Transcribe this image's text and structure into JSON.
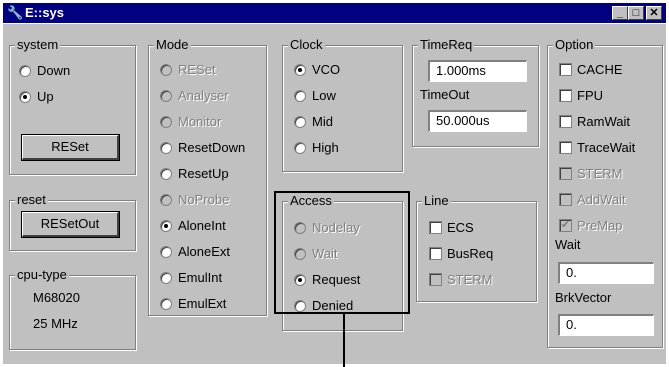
{
  "window": {
    "title": "E::sys",
    "icon": "wrench-icon"
  },
  "titlebar_buttons": {
    "minimize": "_",
    "maximize": "□",
    "close": "✕"
  },
  "system": {
    "title": "system",
    "options": [
      {
        "label": "Down",
        "selected": false
      },
      {
        "label": "Up",
        "selected": true
      }
    ],
    "button": "RESet"
  },
  "reset": {
    "title": "reset",
    "button": "RESetOut"
  },
  "cpu": {
    "title": "cpu-type",
    "model": "M68020",
    "speed": "25 MHz"
  },
  "mode": {
    "title": "Mode",
    "options": [
      {
        "label": "RESet",
        "selected": false,
        "enabled": false
      },
      {
        "label": "Analyser",
        "selected": false,
        "enabled": false
      },
      {
        "label": "Monitor",
        "selected": false,
        "enabled": false
      },
      {
        "label": "ResetDown",
        "selected": false,
        "enabled": true
      },
      {
        "label": "ResetUp",
        "selected": false,
        "enabled": true
      },
      {
        "label": "NoProbe",
        "selected": false,
        "enabled": false
      },
      {
        "label": "AloneInt",
        "selected": true,
        "enabled": true
      },
      {
        "label": "AloneExt",
        "selected": false,
        "enabled": true
      },
      {
        "label": "EmulInt",
        "selected": false,
        "enabled": true
      },
      {
        "label": "EmulExt",
        "selected": false,
        "enabled": true
      }
    ]
  },
  "clock": {
    "title": "Clock",
    "options": [
      {
        "label": "VCO",
        "selected": true
      },
      {
        "label": "Low",
        "selected": false
      },
      {
        "label": "Mid",
        "selected": false
      },
      {
        "label": "High",
        "selected": false
      }
    ]
  },
  "access": {
    "title": "Access",
    "options": [
      {
        "label": "Nodelay",
        "selected": false,
        "enabled": false
      },
      {
        "label": "Wait",
        "selected": false,
        "enabled": false
      },
      {
        "label": "Request",
        "selected": true,
        "enabled": true
      },
      {
        "label": "Denied",
        "selected": false,
        "enabled": true
      }
    ]
  },
  "timereq": {
    "title": "TimeReq",
    "value": "1.000ms"
  },
  "timeout": {
    "title": "TimeOut",
    "value": "50.000us"
  },
  "line": {
    "title": "Line",
    "options": [
      {
        "label": "ECS",
        "checked": false,
        "enabled": true
      },
      {
        "label": "BusReq",
        "checked": false,
        "enabled": true
      },
      {
        "label": "STERM",
        "checked": false,
        "enabled": false
      }
    ]
  },
  "option": {
    "title": "Option",
    "options": [
      {
        "label": "CACHE",
        "checked": false,
        "enabled": true
      },
      {
        "label": "FPU",
        "checked": false,
        "enabled": true
      },
      {
        "label": "RamWait",
        "checked": false,
        "enabled": true
      },
      {
        "label": "TraceWait",
        "checked": false,
        "enabled": true
      },
      {
        "label": "STERM",
        "checked": false,
        "enabled": false
      },
      {
        "label": "AddWait",
        "checked": false,
        "enabled": false
      },
      {
        "label": "PreMap",
        "checked": true,
        "enabled": false
      }
    ]
  },
  "wait": {
    "title": "Wait",
    "value": "0."
  },
  "brkvector": {
    "title": "BrkVector",
    "value": "0."
  }
}
